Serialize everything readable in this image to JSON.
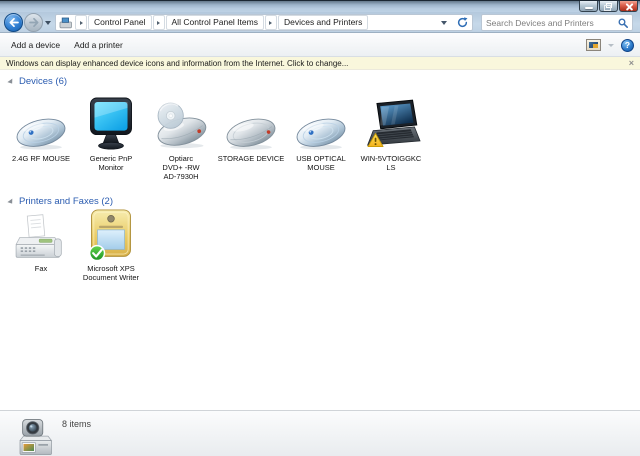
{
  "window": {
    "controls": [
      {
        "name": "minimize"
      },
      {
        "name": "restore"
      },
      {
        "name": "close"
      }
    ]
  },
  "navbar": {
    "breadcrumb": [
      "Control Panel",
      "All Control Panel Items",
      "Devices and Printers"
    ],
    "search_placeholder": "Search Devices and Printers"
  },
  "toolbar": {
    "buttons": [
      "Add a device",
      "Add a printer"
    ],
    "help_glyph": "?"
  },
  "infobar": {
    "message": "Windows can display enhanced device icons and information from the Internet. Click to change...",
    "close_glyph": "×"
  },
  "sections": [
    {
      "title": "Devices (6)",
      "items": [
        {
          "label": "2.4G RF MOUSE",
          "icon": "mouse-icon"
        },
        {
          "label": "Generic PnP\nMonitor",
          "icon": "monitor-icon"
        },
        {
          "label": "Optiarc\nDVD+ -RW\nAD-7930H",
          "icon": "dvd-drive-icon"
        },
        {
          "label": "STORAGE DEVICE",
          "icon": "storage-device-icon"
        },
        {
          "label": "USB OPTICAL\nMOUSE",
          "icon": "mouse-icon"
        },
        {
          "label": "WIN-5VTOIGGKC\nLS",
          "icon": "laptop-icon",
          "badge": "warning"
        }
      ]
    },
    {
      "title": "Printers and Faxes (2)",
      "items": [
        {
          "label": "Fax",
          "icon": "fax-icon"
        },
        {
          "label": "Microsoft XPS\nDocument Writer",
          "icon": "xps-printer-icon",
          "badge": "default-printer-check"
        }
      ]
    }
  ],
  "statusbar": {
    "items_count": "8 items",
    "icon": "devices-collection-icon"
  },
  "colors": {
    "glass_blue": "#b7cce0",
    "infobar_bg": "#f9f7dc",
    "section_header_blue": "#2b5cb0",
    "warning_yellow": "#f5c518",
    "default_green": "#2fae33"
  }
}
